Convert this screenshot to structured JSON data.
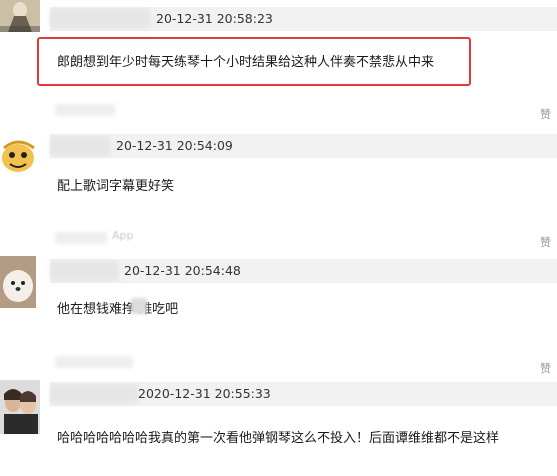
{
  "comments": [
    {
      "timestamp": "20-12-31 20:58:23",
      "text": "郎朗想到年少时每天练琴十个小时结果给这种人伴奏不禁悲从中来",
      "like": ""
    },
    {
      "timestamp": "20-12-31 20:54:09",
      "text": "配上歌词字幕更好笑",
      "like": "赞"
    },
    {
      "timestamp": "20-12-31 20:54:48",
      "text": "他在想钱难挣   难吃吧",
      "like": "赞"
    },
    {
      "timestamp": "2020-12-31 20:55:33",
      "text": "哈哈哈哈哈哈哈我真的第一次看他弹钢琴这么不投入！后面谭维维都不是这样",
      "like": "赞"
    }
  ],
  "likes": {
    "c0": "",
    "c1": "赞",
    "c2": "赞",
    "c3": "赞"
  },
  "source": "App",
  "colors": {
    "highlight": "#e03a3a",
    "meta_bg": "#f1f1f1"
  }
}
